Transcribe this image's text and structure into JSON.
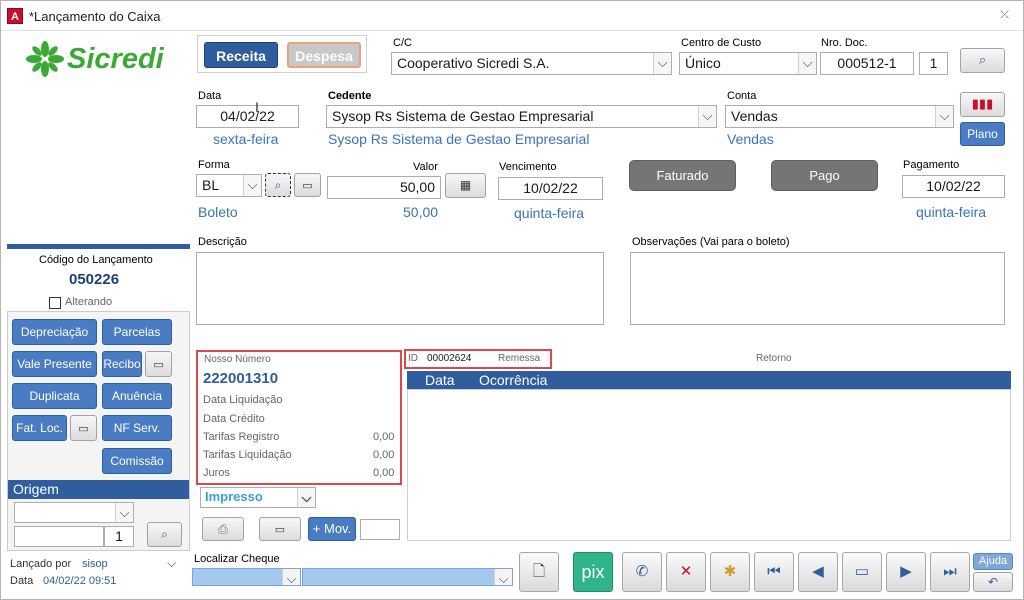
{
  "window": {
    "title": "*Lançamento do Caixa"
  },
  "logo": {
    "text": "Sicredi"
  },
  "tipo": {
    "receita": "Receita",
    "despesa": "Despesa"
  },
  "cc": {
    "label": "C/C",
    "value": "Cooperativo Sicredi S.A."
  },
  "centro": {
    "label": "Centro de Custo",
    "value": "Único"
  },
  "nrodoc": {
    "label": "Nro. Doc.",
    "value": "000512-1",
    "parcela": "1"
  },
  "data": {
    "label": "Data",
    "value": "04/02/22",
    "weekday": "sexta-feira"
  },
  "cedente": {
    "label": "Cedente",
    "value": "Sysop Rs Sistema de Gestao Empresarial",
    "sub": "Sysop Rs Sistema de Gestao Empresarial"
  },
  "conta": {
    "label": "Conta",
    "value": "Vendas",
    "sub": "Vendas",
    "plano": "Plano"
  },
  "forma": {
    "label": "Forma",
    "value": "BL",
    "sub": "Boleto"
  },
  "valor": {
    "label": "Valor",
    "value": "50,00",
    "sub": "50,00"
  },
  "vencimento": {
    "label": "Vencimento",
    "value": "10/02/22",
    "weekday": "quinta-feira"
  },
  "status": {
    "faturado": "Faturado",
    "pago": "Pago"
  },
  "pagamento": {
    "label": "Pagamento",
    "value": "10/02/22",
    "weekday": "quinta-feira"
  },
  "descricao": {
    "label": "Descrição"
  },
  "observacoes": {
    "label": "Observações (Vai para o boleto)"
  },
  "codigo": {
    "label": "Código do Lançamento",
    "value": "050226",
    "alterando": "Alterando"
  },
  "leftbtns": {
    "depreciacao": "Depreciação",
    "parcelas": "Parcelas",
    "vale": "Vale Presente",
    "recibo": "Recibo",
    "duplicata": "Duplicata",
    "anuencia": "Anuência",
    "fatloc": "Fat. Loc.",
    "nfserv": "NF Serv.",
    "comissao": "Comissão"
  },
  "origem": {
    "label": "Origem",
    "num": "1"
  },
  "lancado": {
    "label": "Lançado por",
    "user": "sisop",
    "data_label": "Data",
    "data_value": "04/02/22 09:51"
  },
  "boleto": {
    "nosso_label": "Nosso Número",
    "nosso_value": "222001310",
    "liq_label": "Data Liquidação",
    "cred_label": "Data Crédito",
    "tarreg_label": "Tarifas Registro",
    "tarreg_value": "0,00",
    "tarliq_label": "Tarifas Liquidação",
    "tarliq_value": "0,00",
    "juros_label": "Juros",
    "juros_value": "0,00",
    "impresso": "Impresso"
  },
  "remessa": {
    "id_label": "ID",
    "id_value": "00002624",
    "remessa_label": "Remessa",
    "retorno_label": "Retorno"
  },
  "grid": {
    "columns": [
      "Data",
      "Ocorrência"
    ]
  },
  "mov": {
    "label": "+ Mov."
  },
  "cheque": {
    "label": "Localizar Cheque"
  },
  "bottom": {
    "pix": "pix",
    "ajuda": "Ajuda"
  },
  "colors": {
    "accent": "#2f5d9e",
    "sicredi_green": "#3aa935",
    "red_highlight": "#e0474c"
  }
}
